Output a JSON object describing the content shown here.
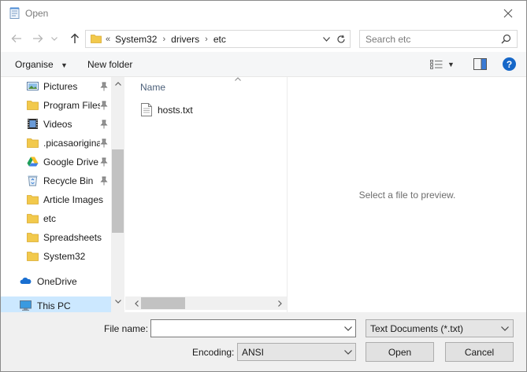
{
  "window": {
    "title": "Open"
  },
  "address": {
    "overflow_glyph": "«",
    "breadcrumbs": [
      "System32",
      "drivers",
      "etc"
    ],
    "separator": "›"
  },
  "search": {
    "placeholder": "Search etc"
  },
  "toolbar": {
    "organise_label": "Organise",
    "new_folder_label": "New folder"
  },
  "nav": {
    "items": [
      {
        "label": "Pictures",
        "icon": "pictures-icon",
        "pinned": true
      },
      {
        "label": "Program Files",
        "icon": "folder-icon",
        "pinned": true
      },
      {
        "label": "Videos",
        "icon": "videos-icon",
        "pinned": true
      },
      {
        "label": ".picasaoriginals",
        "icon": "folder-icon",
        "pinned": true
      },
      {
        "label": "Google Drive",
        "icon": "google-drive-icon",
        "pinned": true
      },
      {
        "label": "Recycle Bin",
        "icon": "recycle-bin-icon",
        "pinned": true
      },
      {
        "label": "Article Images",
        "icon": "folder-icon",
        "pinned": false
      },
      {
        "label": "etc",
        "icon": "folder-icon",
        "pinned": false
      },
      {
        "label": "Spreadsheets",
        "icon": "folder-icon",
        "pinned": false
      },
      {
        "label": "System32",
        "icon": "folder-icon",
        "pinned": false
      }
    ],
    "onedrive_label": "OneDrive",
    "thispc_label": "This PC"
  },
  "files": {
    "column_name": "Name",
    "items": [
      {
        "name": "hosts.txt",
        "icon": "text-file-icon"
      }
    ]
  },
  "preview": {
    "message": "Select a file to preview."
  },
  "bottom": {
    "file_name_label": "File name:",
    "file_name_value": "",
    "file_type": "Text Documents (*.txt)",
    "encoding_label": "Encoding:",
    "encoding_value": "ANSI",
    "open_label": "Open",
    "cancel_label": "Cancel"
  },
  "colors": {
    "accent": "#1667c8",
    "selection": "#cce8ff",
    "folder": "#f2c94c"
  }
}
